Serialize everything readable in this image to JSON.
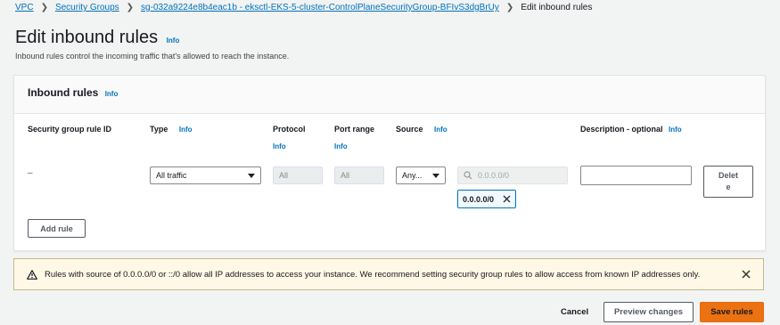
{
  "breadcrumb": {
    "items": [
      "VPC",
      "Security Groups",
      "sg-032a9224e8b4eac1b - eksctl-EKS-5-cluster-ControlPlaneSecurityGroup-BFIvS3dgBrUy"
    ],
    "current": "Edit inbound rules"
  },
  "page": {
    "title": "Edit inbound rules",
    "info": "Info",
    "subtitle": "Inbound rules control the incoming traffic that's allowed to reach the instance."
  },
  "panel": {
    "title": "Inbound rules",
    "info": "Info",
    "columns": {
      "rule_id": "Security group rule ID",
      "type": "Type",
      "protocol": "Protocol",
      "port_range": "Port range",
      "source": "Source",
      "description": "Description - optional",
      "info": "Info"
    },
    "row": {
      "rule_id": "–",
      "type": "All traffic",
      "protocol": "All",
      "port_range": "All",
      "source_type": "Any...",
      "source_placeholder": "0.0.0.0/0",
      "source_token": "0.0.0.0/0",
      "description": "",
      "delete_label_1": "Delet",
      "delete_label_2": "e"
    },
    "add_rule": "Add rule"
  },
  "warning": {
    "text": "Rules with source of 0.0.0.0/0 or ::/0 allow all IP addresses to access your instance. We recommend setting security group rules to allow access from known IP addresses only."
  },
  "footer": {
    "cancel": "Cancel",
    "preview": "Preview changes",
    "save": "Save rules"
  },
  "colors": {
    "link": "#0073bb",
    "primary": "#ec7211",
    "warning_bg": "#fff8e6"
  }
}
